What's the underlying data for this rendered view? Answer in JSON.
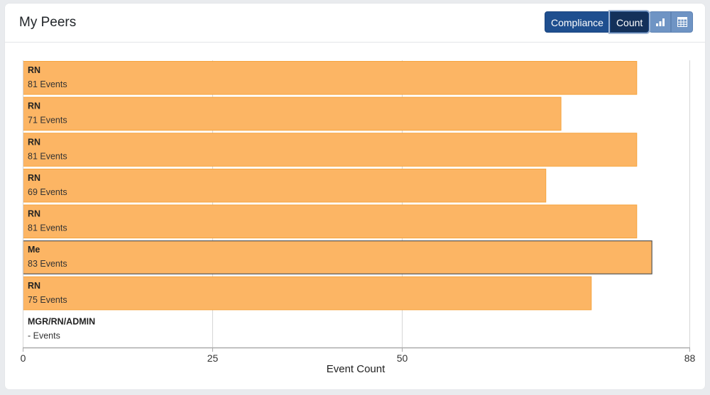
{
  "header": {
    "title": "My Peers",
    "toggle": {
      "compliance_label": "Compliance",
      "count_label": "Count",
      "active": "Count"
    },
    "view_buttons": [
      {
        "icon": "bar-chart-icon"
      },
      {
        "icon": "table-icon"
      }
    ]
  },
  "colors": {
    "bar_fill": "#fcb564",
    "bar_stroke": "#f6a43d",
    "highlight_stroke": "#555555",
    "grid": "#d6d6d6",
    "axis": "#aaaaaa"
  },
  "chart_data": {
    "type": "bar",
    "orientation": "horizontal",
    "title": "",
    "xlabel": "Event Count",
    "ylabel": "",
    "xlim": [
      0,
      88
    ],
    "xticks": [
      0,
      25,
      50,
      88
    ],
    "grid": true,
    "categories": [
      "RN",
      "RN",
      "RN",
      "RN",
      "RN",
      "Me",
      "RN",
      "MGR/RN/ADMIN"
    ],
    "values": [
      81,
      71,
      81,
      69,
      81,
      83,
      75,
      null
    ],
    "value_labels": [
      "81 Events",
      "71 Events",
      "81 Events",
      "69 Events",
      "81 Events",
      "83 Events",
      "75 Events",
      "- Events"
    ],
    "highlighted_index": 5
  }
}
